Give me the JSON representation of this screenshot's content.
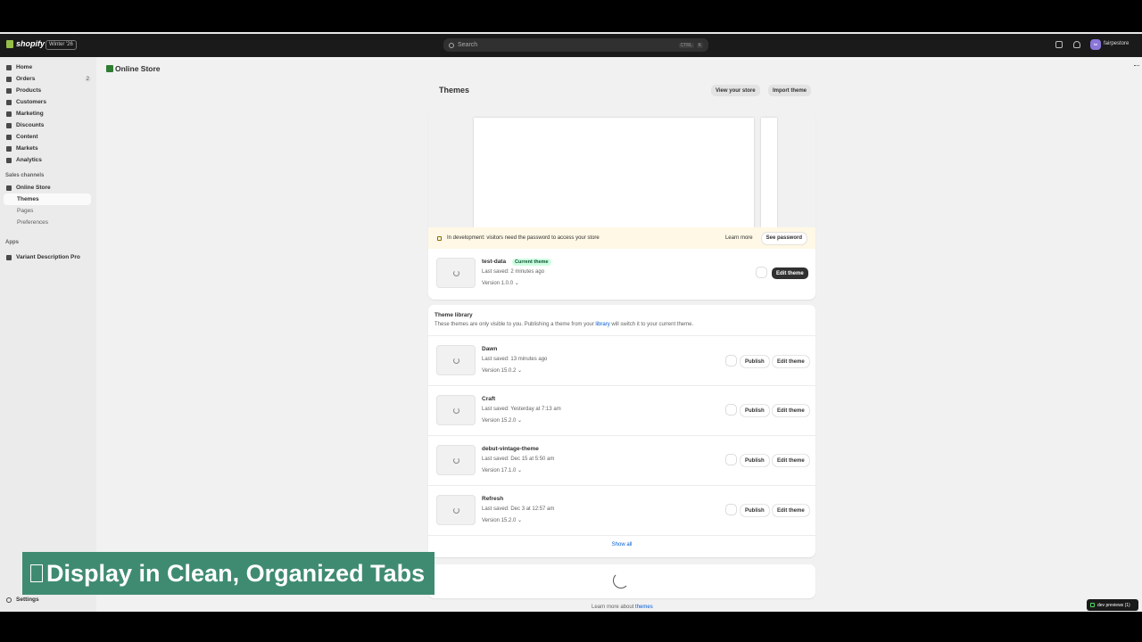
{
  "topbar": {
    "logo_text": "shopify",
    "edition": "Winter '26",
    "search_placeholder": "Search",
    "shortcut_ctrl": "CTRL",
    "shortcut_k": "K",
    "avatar_initials": "fai",
    "store_name": "fairpestore"
  },
  "sidebar": {
    "items": [
      {
        "label": "Home",
        "icon": "home-icon"
      },
      {
        "label": "Orders",
        "icon": "orders-icon",
        "count": "2"
      },
      {
        "label": "Products",
        "icon": "tag-icon"
      },
      {
        "label": "Customers",
        "icon": "person-icon"
      },
      {
        "label": "Marketing",
        "icon": "target-icon"
      },
      {
        "label": "Discounts",
        "icon": "discount-icon"
      },
      {
        "label": "Content",
        "icon": "content-icon"
      },
      {
        "label": "Markets",
        "icon": "globe-icon"
      },
      {
        "label": "Analytics",
        "icon": "chart-icon"
      }
    ],
    "sales_channels_label": "Sales channels",
    "online_store_label": "Online Store",
    "sub_items": [
      "Themes",
      "Pages",
      "Preferences"
    ],
    "apps_label": "Apps",
    "app_items": [
      "Variant Description Pro"
    ],
    "settings_label": "Settings"
  },
  "main": {
    "store_title": "Online Store",
    "page_title": "Themes",
    "view_store_label": "View your store",
    "import_theme_label": "Import theme",
    "banner_text": "In development: visitors need the password to access your store",
    "learn_more_label": "Learn more",
    "see_password_label": "See password",
    "current": {
      "name": "test-data",
      "badge": "Current theme",
      "saved": "Last saved: 2 minutes ago",
      "version": "Version 1.0.0",
      "edit_label": "Edit theme"
    },
    "library": {
      "title": "Theme library",
      "desc_before": "These themes are only visible to you. Publishing a theme from your ",
      "desc_link": "library",
      "desc_after": " will switch it to your current theme.",
      "publish_label": "Publish",
      "edit_label": "Edit theme",
      "themes": [
        {
          "name": "Dawn",
          "saved": "Last saved: 13 minutes ago",
          "version": "Version 15.0.2"
        },
        {
          "name": "Craft",
          "saved": "Last saved: Yesterday at 7:13 am",
          "version": "Version 15.2.0"
        },
        {
          "name": "debut-vintage-theme",
          "saved": "Last saved: Dec 15 at 5:50 am",
          "version": "Version 17.1.0"
        },
        {
          "name": "Refresh",
          "saved": "Last saved: Dec 3 at 12:57 am",
          "version": "Version 15.2.0"
        }
      ],
      "show_all_label": "Show all"
    },
    "footer_before": "Learn more about ",
    "footer_link": "themes"
  },
  "dev_preview_label": "dev previews (1)",
  "caption_text": "Display in Clean, Organized Tabs"
}
